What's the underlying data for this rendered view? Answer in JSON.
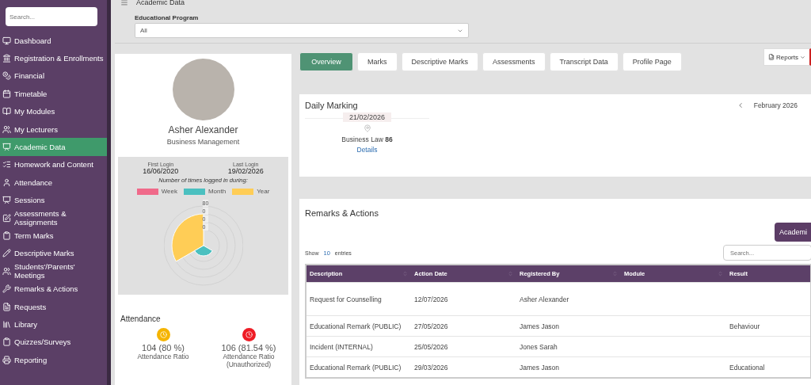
{
  "sidebar": {
    "search_placeholder": "Search...",
    "items": [
      {
        "label": "Dashboard",
        "selected": false
      },
      {
        "label": "Registration & Enrollments",
        "selected": false
      },
      {
        "label": "Financial",
        "selected": false
      },
      {
        "label": "Timetable",
        "selected": false
      },
      {
        "label": "My Modules",
        "selected": false
      },
      {
        "label": "My Lecturers",
        "selected": false
      },
      {
        "label": "Academic Data",
        "selected": true
      },
      {
        "label": "Homework and Content",
        "selected": false
      },
      {
        "label": "Attendance",
        "selected": false
      },
      {
        "label": "Sessions",
        "selected": false
      },
      {
        "label": "Assessments & Assignments",
        "selected": false
      },
      {
        "label": "Term Marks",
        "selected": false
      },
      {
        "label": "Descriptive Marks",
        "selected": false
      },
      {
        "label": "Students'/Parents' Meetings",
        "selected": false
      },
      {
        "label": "Remarks & Actions",
        "selected": false
      },
      {
        "label": "Requests",
        "selected": false
      },
      {
        "label": "Library",
        "selected": false
      },
      {
        "label": "Quizzes/Surveys",
        "selected": false
      },
      {
        "label": "Reporting",
        "selected": false
      }
    ]
  },
  "header": {
    "title": "Academic Data",
    "program_label": "Educational Program",
    "program_value": "All"
  },
  "profile": {
    "name": "Asher Alexander",
    "program": "Business Management",
    "first_login_label": "First Login",
    "first_login": "16/06/2020",
    "last_login_label": "Last Login",
    "last_login": "19/02/2026",
    "logins_caption": "Number of times logged in during:",
    "legend": [
      {
        "label": "Week",
        "color": "#f06a8a"
      },
      {
        "label": "Month",
        "color": "#4bc0c0"
      },
      {
        "label": "Year",
        "color": "#ffcd56"
      }
    ],
    "radial_ticks": [
      "80",
      "0",
      "0",
      "0"
    ]
  },
  "attendance": {
    "title": "Attendance",
    "stats": [
      {
        "value": "104 (80 %)",
        "label": "Attendance Ratio",
        "color": "#f5b400"
      },
      {
        "value": "106 (81.54 %)",
        "label": "Attendance Ratio (Unauthorized)",
        "color": "#ee1c25"
      }
    ]
  },
  "tabs": [
    {
      "label": "Overview",
      "selected": true
    },
    {
      "label": "Marks",
      "selected": false
    },
    {
      "label": "Descriptive Marks",
      "selected": false
    },
    {
      "label": "Assessments",
      "selected": false
    },
    {
      "label": "Transcript Data",
      "selected": false
    },
    {
      "label": "Profile Page",
      "selected": false
    }
  ],
  "reports_button": "Reports",
  "daily_marking": {
    "title": "Daily Marking",
    "month": "February 2026",
    "date": "21/02/2026",
    "entry": "Business Law **86**",
    "link": "Details"
  },
  "remarks": {
    "title": "Remarks & Actions",
    "action_button": "Academi",
    "show": "Show",
    "entries_count": "10",
    "entries": "entries",
    "search_placeholder": "Search...",
    "columns": [
      "Description",
      "Action Date",
      "Registered By",
      "Module",
      "Result"
    ],
    "rows": [
      [
        "Request for Counselling",
        "12/07/2026",
        "Asher Alexander",
        "",
        ""
      ],
      [
        "Educational Remark (PUBLIC)",
        "27/05/2026",
        "James Jason",
        "",
        "Behaviour"
      ],
      [
        "Incident (INTERNAL)",
        "25/05/2026",
        "Jones Sarah",
        "",
        ""
      ],
      [
        "Educational Remark (PUBLIC)",
        "29/03/2026",
        "James Jason",
        "",
        "Educational"
      ]
    ]
  }
}
